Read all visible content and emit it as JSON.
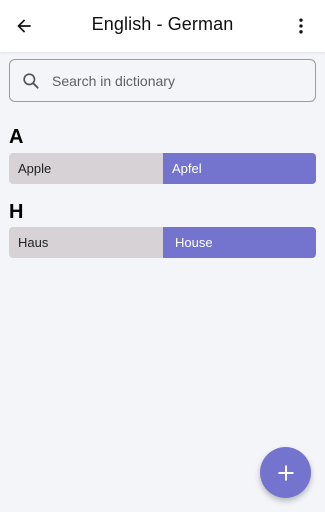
{
  "app_bar": {
    "title": "English - German",
    "back_icon": "arrow-left-icon",
    "menu_icon": "more-vertical-icon"
  },
  "search": {
    "placeholder": "Search in dictionary",
    "value": "",
    "icon": "search-icon"
  },
  "sections": [
    {
      "letter": "A",
      "entries": [
        {
          "source": "Apple",
          "target": "Apfel"
        }
      ]
    },
    {
      "letter": "H",
      "entries": [
        {
          "source": "Haus",
          "target": "House"
        }
      ]
    }
  ],
  "fab": {
    "icon": "plus-icon"
  },
  "colors": {
    "accent": "#7474cf",
    "source_cell": "#d6d2d6",
    "background": "#f4f5f8"
  }
}
